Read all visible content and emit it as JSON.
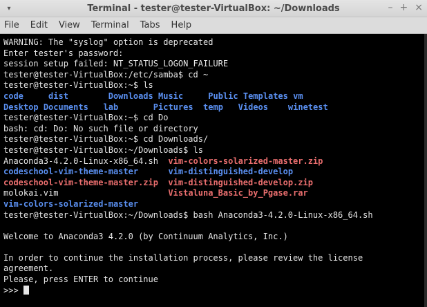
{
  "window": {
    "title": "Terminal - tester@tester-VirtualBox: ~/Downloads",
    "menu_glyph": "▾",
    "controls": {
      "minimize": "–",
      "maximize": "+",
      "close": "×"
    }
  },
  "menubar": [
    "File",
    "Edit",
    "View",
    "Terminal",
    "Tabs",
    "Help"
  ],
  "terminal": {
    "lines": [
      [
        {
          "t": "WARNING: The \"syslog\" option is deprecated"
        }
      ],
      [
        {
          "t": "Enter tester's password:"
        }
      ],
      [
        {
          "t": "session setup failed: NT_STATUS_LOGON_FAILURE"
        }
      ],
      [
        {
          "t": "tester@tester-VirtualBox:/etc/samba$ cd ~"
        }
      ],
      [
        {
          "t": "tester@tester-VirtualBox:~$ ls"
        }
      ],
      [
        {
          "t": "code",
          "c": "blue"
        },
        {
          "t": "     "
        },
        {
          "t": "dist",
          "c": "blue"
        },
        {
          "t": "        "
        },
        {
          "t": "Downloads",
          "c": "blue"
        },
        {
          "t": " "
        },
        {
          "t": "Music",
          "c": "blue"
        },
        {
          "t": "     "
        },
        {
          "t": "Public",
          "c": "blue"
        },
        {
          "t": " "
        },
        {
          "t": "Templates",
          "c": "blue"
        },
        {
          "t": " "
        },
        {
          "t": "vm",
          "c": "blue"
        }
      ],
      [
        {
          "t": "Desktop",
          "c": "blue"
        },
        {
          "t": " "
        },
        {
          "t": "Documents",
          "c": "blue"
        },
        {
          "t": "   "
        },
        {
          "t": "lab",
          "c": "blue"
        },
        {
          "t": "       "
        },
        {
          "t": "Pictures",
          "c": "blue"
        },
        {
          "t": "  "
        },
        {
          "t": "temp",
          "c": "blue"
        },
        {
          "t": "   "
        },
        {
          "t": "Videos",
          "c": "blue"
        },
        {
          "t": "    "
        },
        {
          "t": "winetest",
          "c": "blue"
        }
      ],
      [
        {
          "t": "tester@tester-VirtualBox:~$ cd Do"
        }
      ],
      [
        {
          "t": "bash: cd: Do: No such file or directory"
        }
      ],
      [
        {
          "t": "tester@tester-VirtualBox:~$ cd Downloads/"
        }
      ],
      [
        {
          "t": "tester@tester-VirtualBox:~/Downloads$ ls"
        }
      ],
      [
        {
          "t": "Anaconda3-4.2.0-Linux-x86_64.sh  "
        },
        {
          "t": "vim-colors-solarized-master.zip",
          "c": "red"
        }
      ],
      [
        {
          "t": "codeschool-vim-theme-master",
          "c": "blue"
        },
        {
          "t": "      "
        },
        {
          "t": "vim-distinguished-develop",
          "c": "blue"
        }
      ],
      [
        {
          "t": "codeschool-vim-theme-master.zip",
          "c": "red"
        },
        {
          "t": "  "
        },
        {
          "t": "vim-distinguished-develop.zip",
          "c": "red"
        }
      ],
      [
        {
          "t": "molokai.vim                      "
        },
        {
          "t": "Vistaluna_Basic_by_Pgase.rar",
          "c": "red"
        }
      ],
      [
        {
          "t": "vim-colors-solarized-master",
          "c": "blue"
        }
      ],
      [
        {
          "t": "tester@tester-VirtualBox:~/Downloads$ bash Anaconda3-4.2.0-Linux-x86_64.sh"
        }
      ],
      [
        {
          "t": ""
        }
      ],
      [
        {
          "t": "Welcome to Anaconda3 4.2.0 (by Continuum Analytics, Inc.)"
        }
      ],
      [
        {
          "t": ""
        }
      ],
      [
        {
          "t": "In order to continue the installation process, please review the license"
        }
      ],
      [
        {
          "t": "agreement."
        }
      ],
      [
        {
          "t": "Please, press ENTER to continue"
        }
      ],
      [
        {
          "t": ">>> "
        }
      ]
    ]
  }
}
